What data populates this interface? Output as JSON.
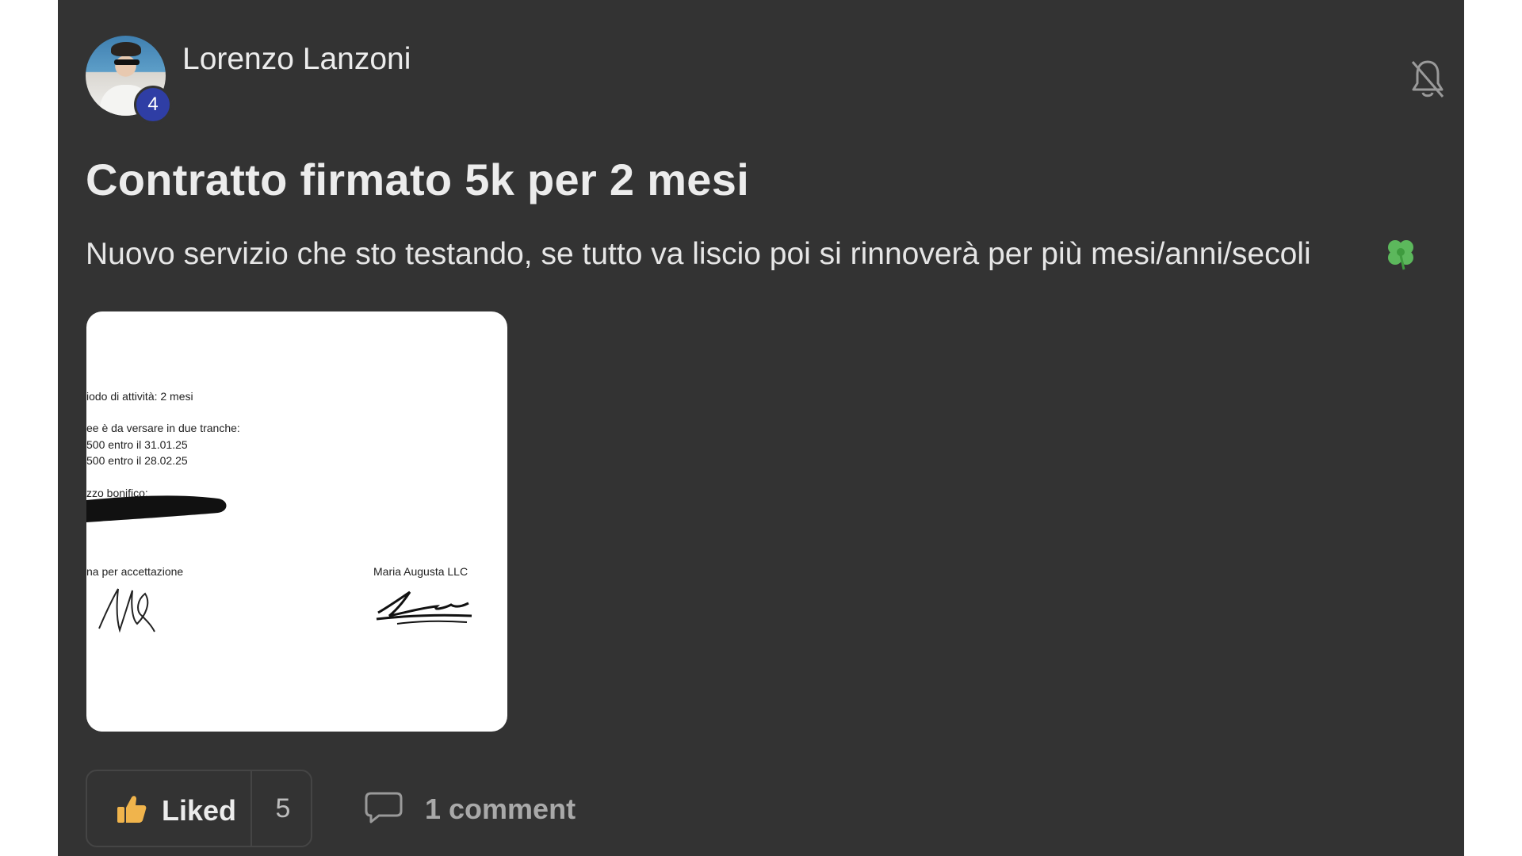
{
  "post": {
    "author": {
      "name": "Lorenzo Lanzoni",
      "level": "4"
    },
    "title": "Contratto firmato 5k per 2 mesi",
    "body": "Nuovo servizio che sto testando, se tutto va liscio poi si rinnoverà per più mesi/anni/secoli",
    "emoji": "four-leaf-clover-icon",
    "attachment": {
      "lines": [
        "iodo di attività: 2 mesi",
        "ee è da versare in due tranche:",
        "500 entro il 31.01.25",
        "500 entro il 28.02.25",
        "zzo bonifico:"
      ],
      "left_signature_label": "na per accettazione",
      "right_signature_label": "Maria Augusta LLC"
    },
    "actions": {
      "like_label": "Liked",
      "like_count": "5",
      "comment_label": "1 comment"
    }
  },
  "colors": {
    "background": "#333333",
    "badge": "#2f3ea5",
    "clover": "#5cb85c",
    "thumb": "#f0b44c"
  }
}
